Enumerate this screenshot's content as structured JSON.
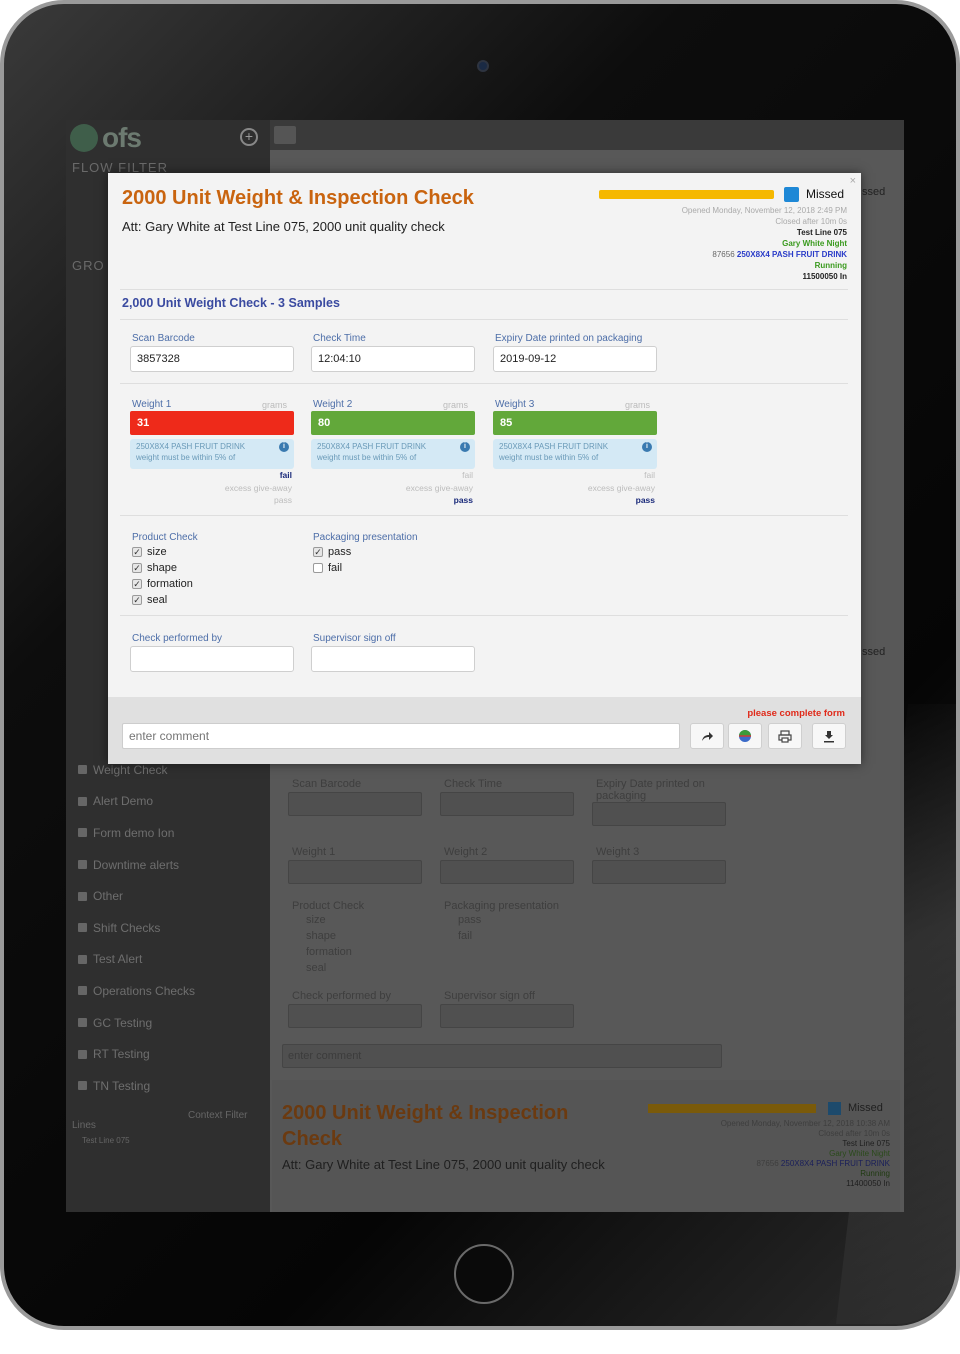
{
  "app": {
    "logo_text": "ofs",
    "sidebar": {
      "flow_filter_heading": "Flow Filter",
      "groups_heading": "Gro",
      "items": [
        "Weight Check",
        "Alert Demo",
        "Form demo Ion",
        "Downtime alerts",
        "Other",
        "Shift Checks",
        "Test Alert",
        "Operations Checks",
        "GC Testing",
        "RT Testing",
        "TN Testing"
      ],
      "lines_label": "Lines",
      "context_filter": "Context Filter",
      "line_item": "Test Line 075"
    }
  },
  "background_form": {
    "scan_barcode": "Scan Barcode",
    "check_time": "Check Time",
    "expiry": "Expiry Date printed on packaging",
    "weight1": "Weight 1",
    "weight2": "Weight 2",
    "weight3": "Weight 3",
    "grams": "grams",
    "product_check": "Product Check",
    "packaging": "Packaging presentation",
    "check_items": [
      "size",
      "shape",
      "formation",
      "seal"
    ],
    "pack_items": [
      "pass",
      "fail"
    ],
    "performed_by": "Check performed by",
    "supervisor": "Supervisor sign off",
    "comment_placeholder": "enter comment",
    "card_title": "2000 Unit Weight & Inspection Check",
    "card_att": "Att: Gary White at Test Line 075, 2000 unit quality check",
    "card_status": "Missed",
    "card_meta": [
      "Opened Monday, November 12, 2018 10:38 AM",
      "Closed after 10m 0s",
      "Test Line 075",
      "Gary White Night",
      "87656",
      "250X8X4 PASH FRUIT DRINK",
      "Running",
      "11400050 In"
    ],
    "right_status_top": "ssed",
    "right_status_mid": "ssed"
  },
  "modal": {
    "close": "×",
    "title": "2000 Unit Weight & Inspection Check",
    "subtitle": "Att: Gary White at Test Line 075, 2000 unit quality check",
    "status": "Missed",
    "status_color": "#1e88d6",
    "progress_color": "#f5b800",
    "opened": "Opened Monday, November 12, 2018 2:49 PM",
    "closed_after": "Closed after 10m 0s",
    "line": "Test Line 075",
    "shift": "Gary White Night",
    "product_code": "87656",
    "product_name": "250X8X4 PASH FRUIT DRINK",
    "run_state": "Running",
    "batch": "11500050 In",
    "section_title": "2,000 Unit Weight Check - 3 Samples",
    "scan_barcode_label": "Scan Barcode",
    "scan_barcode_value": "3857328",
    "check_time_label": "Check Time",
    "check_time_value": "12:04:10",
    "expiry_label": "Expiry Date printed on packaging",
    "expiry_value": "2019-09-12",
    "weights": [
      {
        "label": "Weight 1",
        "unit": "grams",
        "value": "31",
        "state": "fail",
        "info_line1": "250X8X4 PASH FRUIT DRINK",
        "info_line2": "weight must be within 5% of",
        "r1": "fail",
        "r2": "excess give-away",
        "r3": "pass"
      },
      {
        "label": "Weight 2",
        "unit": "grams",
        "value": "80",
        "state": "pass",
        "info_line1": "250X8X4 PASH FRUIT DRINK",
        "info_line2": "weight must be within 5% of",
        "r1": "fail",
        "r2": "excess give-away",
        "r3": "pass"
      },
      {
        "label": "Weight 3",
        "unit": "grams",
        "value": "85",
        "state": "pass",
        "info_line1": "250X8X4 PASH FRUIT DRINK",
        "info_line2": "weight must be within 5% of",
        "r1": "fail",
        "r2": "excess give-away",
        "r3": "pass"
      }
    ],
    "product_check_label": "Product Check",
    "product_checks": [
      {
        "label": "size",
        "checked": true
      },
      {
        "label": "shape",
        "checked": true
      },
      {
        "label": "formation",
        "checked": true
      },
      {
        "label": "seal",
        "checked": true
      }
    ],
    "packaging_label": "Packaging presentation",
    "packaging_checks": [
      {
        "label": "pass",
        "checked": true
      },
      {
        "label": "fail",
        "checked": false
      }
    ],
    "performed_by_label": "Check performed by",
    "performed_by_value": "",
    "supervisor_label": "Supervisor sign off",
    "supervisor_value": "",
    "complete_msg": "please complete form",
    "comment_placeholder": "enter comment",
    "footer_buttons": [
      "share-icon",
      "globe-icon",
      "print-icon",
      "download-icon"
    ]
  }
}
